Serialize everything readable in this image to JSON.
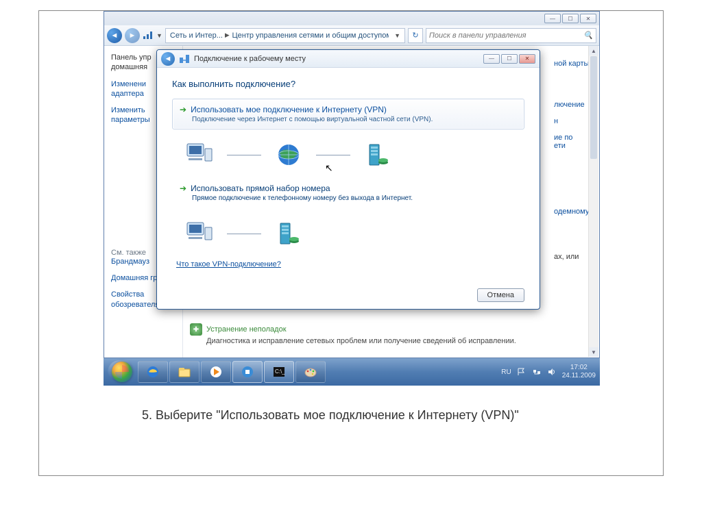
{
  "explorer": {
    "breadcrumb1": "Сеть и Интер...",
    "breadcrumb2": "Центр управления сетями и общим доступом",
    "search_placeholder": "Поиск в панели управления"
  },
  "sidebar": {
    "link1": "Панель упр\nдомашняя",
    "link2": "Изменени\nадаптера",
    "link3": "Изменить\nпараметры",
    "see_also": "См. также",
    "fw": "Брандмауз",
    "hg": "Домашняя группа",
    "ie": "Свойства обозревателя"
  },
  "rightlinks": {
    "a": "ной карты",
    "b": "лючение",
    "c": "н",
    "d": "ие по\nети",
    "e": "одемному",
    "f": "ах, или"
  },
  "trouble": {
    "title": "Устранение неполадок",
    "sub": "Диагностика и исправление сетевых проблем или получение сведений об исправлении."
  },
  "wizard": {
    "title": "Подключение к рабочему месту",
    "heading": "Как выполнить подключение?",
    "opt1_title": "Использовать мое подключение к Интернету (VPN)",
    "opt1_sub": "Подключение через Интернет с помощью виртуальной частной сети (VPN).",
    "opt2_title": "Использовать прямой набор номера",
    "opt2_sub": "Прямое подключение к телефонному номеру без выхода в Интернет.",
    "link": "Что такое VPN-подключение?",
    "cancel": "Отмена"
  },
  "tray": {
    "lang": "RU",
    "time": "17:02",
    "date": "24.11.2009"
  },
  "caption": "5. Выберите \"Использовать мое подключение к Интернету (VPN)\""
}
